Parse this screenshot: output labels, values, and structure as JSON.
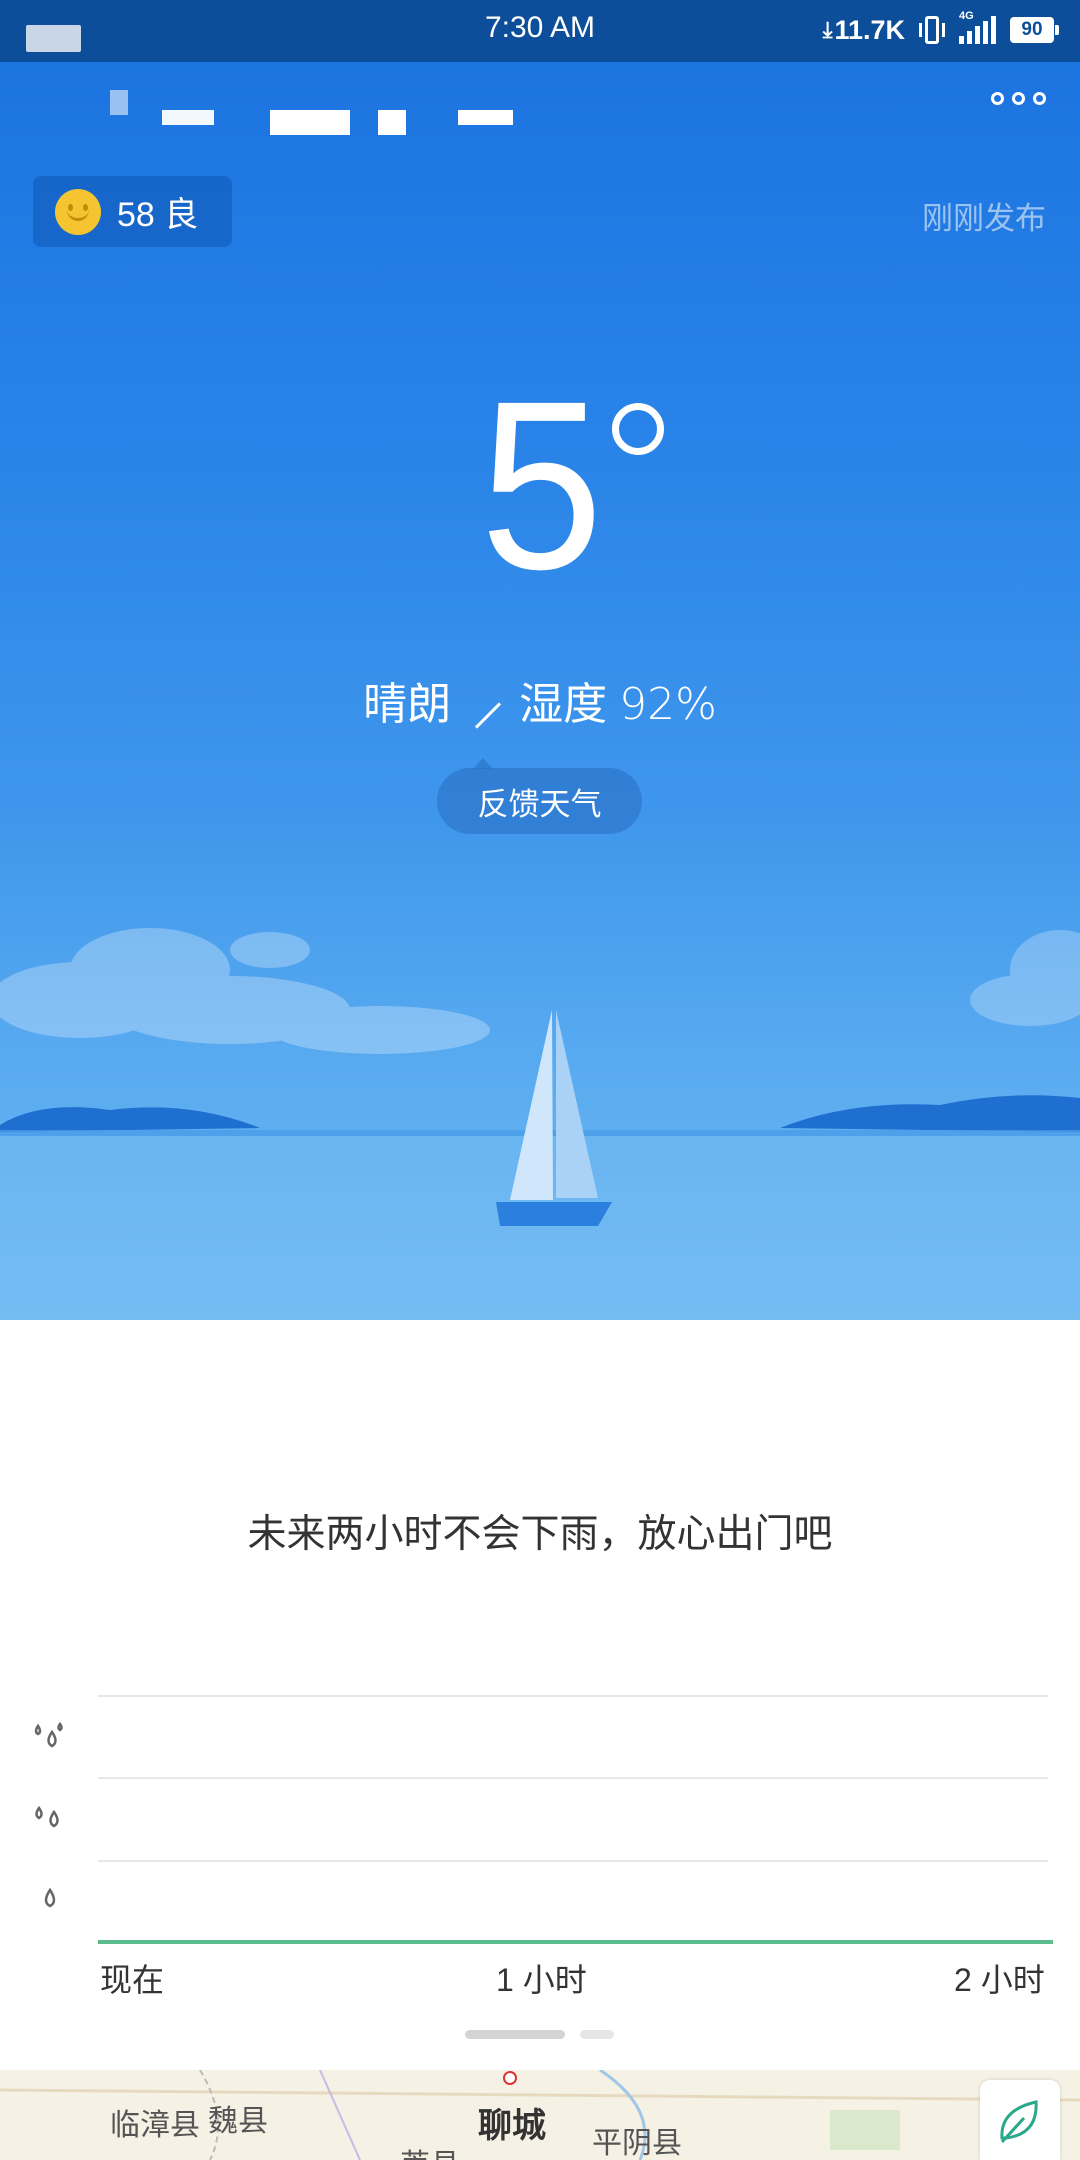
{
  "status_bar": {
    "time": "7:30 AM",
    "net_speed": "11.7K",
    "net_tag": "4G",
    "battery": "90"
  },
  "weather": {
    "aqi_value": "58",
    "aqi_level": "良",
    "publish_time": "刚刚发布",
    "temperature": "5",
    "condition": "晴朗",
    "humidity_label": "湿度",
    "humidity_value": "92%",
    "feedback_label": "反馈天气"
  },
  "precipitation": {
    "message": "未来两小时不会下雨，放心出门吧",
    "x_labels": [
      "现在",
      "1 小时",
      "2 小时"
    ]
  },
  "chart_data": {
    "type": "line",
    "title": "",
    "x": [
      "现在",
      "1 小时",
      "2 小时"
    ],
    "series": [
      {
        "values": [
          0,
          0,
          0
        ]
      }
    ],
    "y_levels": [
      "light-rain-icon",
      "moderate-rain-icon",
      "heavy-rain-icon"
    ],
    "line_color": "#5bbd8c"
  },
  "map": {
    "labels": [
      "临漳县",
      "魏县",
      "聊城",
      "平阴县",
      "莘县"
    ]
  },
  "icons": [
    "smile-icon",
    "more-icon",
    "download-arrow-icon",
    "vibrate-icon",
    "signal-icon",
    "battery-icon",
    "raindrop-icon",
    "leaf-icon"
  ],
  "colors": {
    "status_bar": "#0d4e9a",
    "sky_top": "#1a71df",
    "sky_bottom": "#6fb8f2",
    "aqi_good": "#f5c431",
    "rain_line": "#5bbd8c"
  }
}
